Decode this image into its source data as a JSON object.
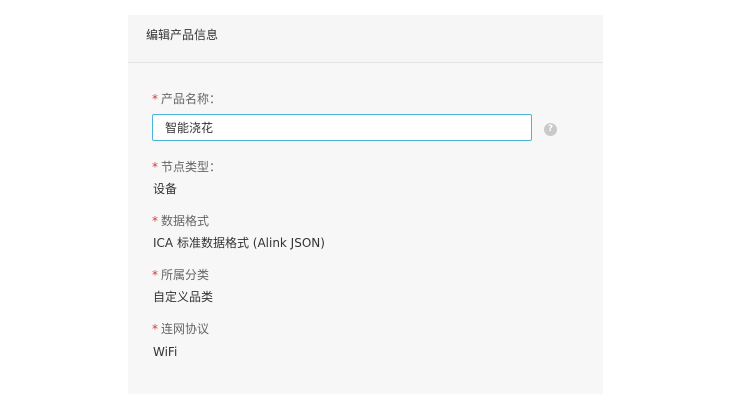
{
  "panel": {
    "title": "编辑产品信息"
  },
  "fields": {
    "required_mark": "*",
    "product_name": {
      "label": "产品名称：",
      "value": "智能浇花"
    },
    "help_icon_glyph": "?",
    "node_type": {
      "label": "节点类型：",
      "value": "设备"
    },
    "data_format": {
      "label": "数据格式",
      "value": "ICA 标准数据格式 (Alink JSON)"
    },
    "category": {
      "label": "所属分类",
      "value": "自定义品类"
    },
    "network_protocol": {
      "label": "连网协议",
      "value": "WiFi"
    }
  },
  "colors": {
    "required": "#d9363e",
    "input_border": "#4fb3d9",
    "panel_bg": "#f7f7f7"
  },
  "icons": {
    "help": "help-icon"
  }
}
